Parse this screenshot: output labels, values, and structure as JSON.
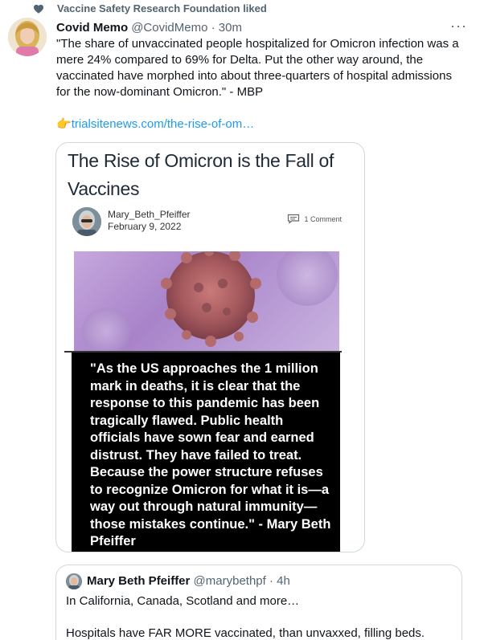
{
  "liked_by": {
    "text": "Vaccine Safety Research Foundation liked"
  },
  "tweet": {
    "display_name": "Covid Memo",
    "handle_time": "@CovidMemo · 30m",
    "more_label": "···",
    "text": "\"The share of unvaccinated people hospitalized for Omicron infection was a mere 24% compared to 69% for Delta. Put the other way around, the vaccinated have morphed into about three-quarters of hospital admissions for the now-dominant Omicron.\" - MBP",
    "link_emoji": "👉",
    "link_text": "trialsitenews.com/the-rise-of-om…"
  },
  "card": {
    "title": "The Rise of Omicron is the Fall of Vaccines",
    "author_name": "Mary_Beth_Pfeiffer",
    "post_date": "February 9, 2022",
    "comment_count": "1 Comment",
    "quote": "\"As the US approaches the 1 million mark in deaths, it is clear that the response to this pandemic has been tragically flawed. Public health officials have sown fear and earned distrust. They have failed to treat. Because the power structure refuses to recognize Omicron for what it is—a way out through natural immunity—those mistakes continue.\" - Mary Beth Pfeiffer"
  },
  "quoted_tweet": {
    "display_name": "Mary Beth Pfeiffer",
    "handle_time": "@marybethpf · 4h",
    "line1": "In California, Canada, Scotland and more…",
    "line2": "Hospitals have FAR MORE vaccinated, than unvaxxed, filling beds."
  },
  "colors": {
    "accent": "#1d9bf0",
    "secondary_text": "#536471",
    "border": "#cfd9de"
  },
  "icons": [
    "heart-icon",
    "more-icon",
    "pointing-hand-icon",
    "comment-icon"
  ]
}
